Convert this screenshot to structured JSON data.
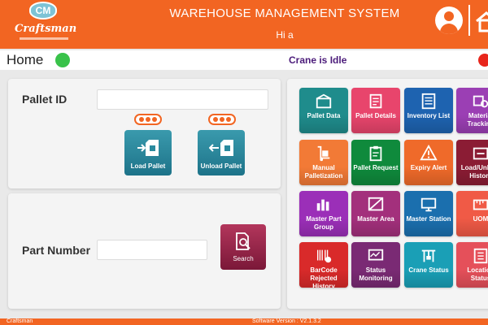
{
  "header": {
    "logo_badge": "CM",
    "logo_text": "Craftsman",
    "title": "WAREHOUSE MANAGEMENT SYSTEM",
    "greeting": "Hi a"
  },
  "statusbar": {
    "page": "Home",
    "crane_status": "Crane is Idle"
  },
  "pallet_panel": {
    "label": "Pallet ID",
    "value": "",
    "load_label": "Load Pallet",
    "unload_label": "Unload Pallet"
  },
  "part_panel": {
    "label": "Part Number",
    "value": "",
    "search_label": "Search"
  },
  "tiles": [
    {
      "label": "Pallet Data",
      "icon": "pallet-box-icon",
      "color": "#1f8c8c"
    },
    {
      "label": "Pallet Details",
      "icon": "pallet-details-icon",
      "color": "#e8456c"
    },
    {
      "label": "Inventory List",
      "icon": "inventory-list-icon",
      "color": "#1e63b0"
    },
    {
      "label": "Material Tracking",
      "icon": "material-tracking-icon",
      "color": "#9b3fb4"
    },
    {
      "label": "Manual Palletization",
      "icon": "hand-truck-icon",
      "color": "#f27a36"
    },
    {
      "label": "Pallet Request",
      "icon": "clipboard-icon",
      "color": "#0f8a3c"
    },
    {
      "label": "Expiry Alert",
      "icon": "alert-icon",
      "color": "#ef6a2a"
    },
    {
      "label": "Load/Unload History",
      "icon": "history-icon",
      "color": "#8b1c34"
    },
    {
      "label": "Master Part Group",
      "icon": "part-group-icon",
      "color": "#9b2fb8"
    },
    {
      "label": "Master Area",
      "icon": "area-icon",
      "color": "#a3307c"
    },
    {
      "label": "Master Station",
      "icon": "station-icon",
      "color": "#1b6fae"
    },
    {
      "label": "UOM",
      "icon": "uom-icon",
      "color": "#f05a46"
    },
    {
      "label": "BarCode Rejected History",
      "icon": "barcode-reject-icon",
      "color": "#d92a2a"
    },
    {
      "label": "Status Monitoring",
      "icon": "monitoring-icon",
      "color": "#7a2a74"
    },
    {
      "label": "Crane Status",
      "icon": "crane-icon",
      "color": "#1a9fb6"
    },
    {
      "label": "Location Status",
      "icon": "location-icon",
      "color": "#e5505a"
    }
  ],
  "footer": {
    "company": "Craftsman",
    "version": "Software Version : V2.1.3.2"
  },
  "colors": {
    "brand": "#f26522",
    "status_ok": "#39c24a",
    "status_alert": "#e8261c"
  }
}
